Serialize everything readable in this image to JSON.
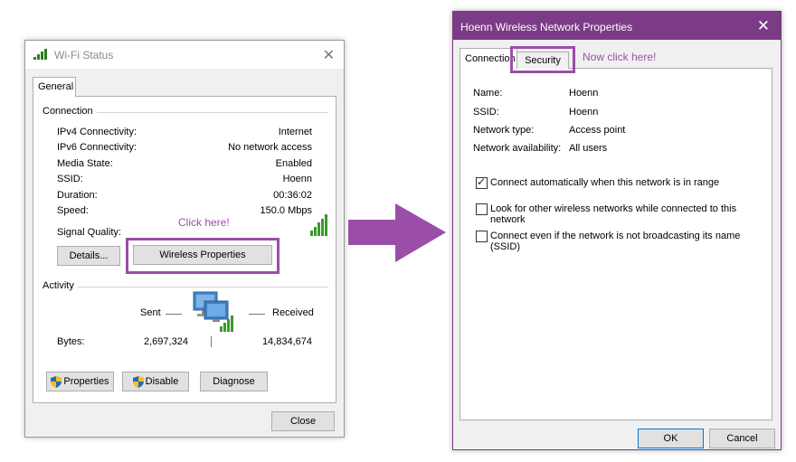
{
  "wifi_status": {
    "title": "Wi-Fi Status",
    "tab": "General",
    "connection_label": "Connection",
    "rows": [
      {
        "label": "IPv4 Connectivity:",
        "value": "Internet"
      },
      {
        "label": "IPv6 Connectivity:",
        "value": "No network access"
      },
      {
        "label": "Media State:",
        "value": "Enabled"
      },
      {
        "label": "SSID:",
        "value": "Hoenn"
      },
      {
        "label": "Duration:",
        "value": "00:36:02"
      },
      {
        "label": "Speed:",
        "value": "150.0 Mbps"
      }
    ],
    "signal_label": "Signal Quality:",
    "details_button": "Details...",
    "wireless_properties_button": "Wireless Properties",
    "activity_label": "Activity",
    "sent_label": "Sent",
    "received_label": "Received",
    "bytes_label": "Bytes:",
    "bytes_sent": "2,697,324",
    "bytes_received": "14,834,674",
    "properties_button": "Properties",
    "disable_button": "Disable",
    "diagnose_button": "Diagnose",
    "close_button": "Close"
  },
  "annotations": {
    "left_hint": "Click here!",
    "right_hint": "Now click here!",
    "highlight_color": "#9b4ea8"
  },
  "network_properties": {
    "title": "Hoenn Wireless Network Properties",
    "tabs": [
      "Connection",
      "Security"
    ],
    "info": [
      {
        "label": "Name:",
        "value": "Hoenn"
      },
      {
        "label": "SSID:",
        "value": "Hoenn"
      },
      {
        "label": "Network type:",
        "value": "Access point"
      },
      {
        "label": "Network availability:",
        "value": "All users"
      }
    ],
    "checkboxes": [
      {
        "label": "Connect automatically when this network is in range",
        "checked": true
      },
      {
        "label": "Look for other wireless networks while connected to this network",
        "checked": false
      },
      {
        "label": "Connect even if the network is not broadcasting its name (SSID)",
        "checked": false
      }
    ],
    "ok_button": "OK",
    "cancel_button": "Cancel",
    "titlebar_color": "#7b3b86"
  },
  "icons": {
    "signal": "wifi-signal-bars-icon",
    "network_computers": "network-computers-icon",
    "shield": "uac-shield-icon",
    "arrow": "right-arrow-icon"
  }
}
